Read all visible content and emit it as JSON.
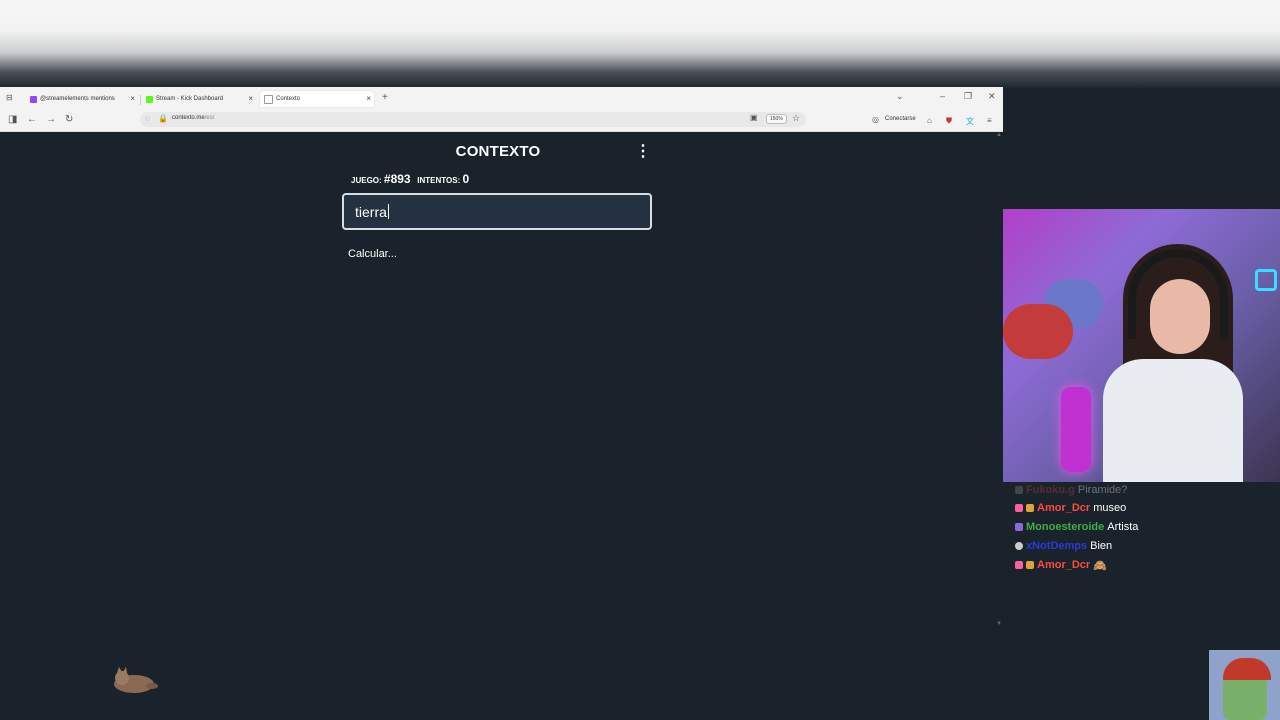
{
  "browser": {
    "tabs": [
      {
        "label": "@streamelements mentions",
        "favicon_color": "#9146ff"
      },
      {
        "label": "Stream - Kick Dashboard",
        "favicon_color": "#53fc18"
      },
      {
        "label": "Contexto",
        "favicon_color": "#ffffff",
        "active": true
      }
    ],
    "url_host": "contexto.me",
    "url_path": "/es/",
    "zoom": "150%",
    "profile_label": "Conectarse"
  },
  "game": {
    "title": "CONTEXTO",
    "game_label": "JUEGO:",
    "game_number": "#893",
    "attempts_label": "INTENTOS:",
    "attempts_value": "0",
    "input_value": "tierra",
    "status": "Calcular..."
  },
  "chat": {
    "messages": [
      {
        "user": "Fukoku.g",
        "text": "Piramide?",
        "user_color": "#d13b3b",
        "badge_color": "#888888",
        "faded": true
      },
      {
        "user": "Amor_Dcr",
        "text": "museo",
        "user_color": "#ff4a3d",
        "badge_color": "#ff5fa2"
      },
      {
        "user": "Monoesteroide",
        "text": "Artista",
        "user_color": "#3fae49",
        "badge_color": "#8c6bd6"
      },
      {
        "user": "xNotDemps",
        "text": "Bien",
        "user_color": "#2a3bd6",
        "badge_color": "#cccccc"
      },
      {
        "user": "Amor_Dcr",
        "text": "🙈",
        "user_color": "#ff4a3d",
        "badge_color": "#ff5fa2"
      }
    ]
  }
}
